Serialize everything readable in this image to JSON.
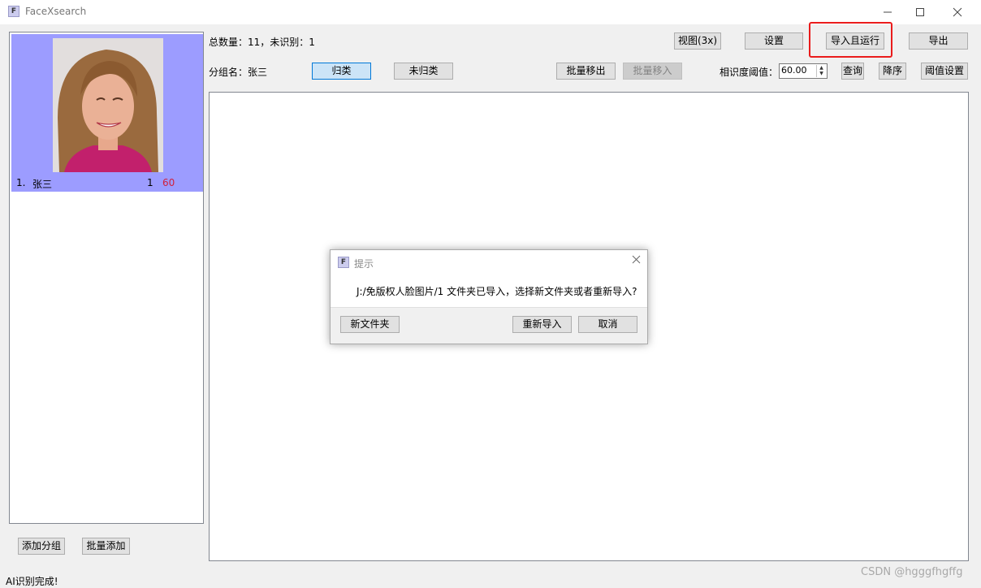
{
  "window": {
    "title": "FaceXsearch",
    "icon_letter": "F"
  },
  "summary": "总数量：11，未识别：1",
  "group_name": "分组名：张三",
  "toolbar": {
    "view_label": "视图(3x)",
    "settings_label": "设置",
    "import_run_label": "导入且运行",
    "export_label": "导出",
    "classified_label": "归类",
    "unclassified_label": "未归类",
    "batch_remove_label": "批量移出",
    "batch_move_in_label": "批量移入",
    "similarity_label": "相识度阈值：",
    "similarity_value": "60.00",
    "query_label": "查询",
    "descending_label": "降序",
    "threshold_settings_label": "阈值设置"
  },
  "groups": [
    {
      "index": "1.",
      "name": "张三",
      "count": "1",
      "score": "60"
    }
  ],
  "sidebar": {
    "add_group_label": "添加分组",
    "batch_add_label": "批量添加"
  },
  "status": "AI识别完成!",
  "dialog": {
    "title": "提示",
    "message": "J:/免版权人脸图片/1 文件夹已导入，选择新文件夹或者重新导入?",
    "new_folder_label": "新文件夹",
    "reimport_label": "重新导入",
    "cancel_label": "取消"
  },
  "watermark": "CSDN @hgggfhgffg",
  "colors": {
    "group_card_bg": "#9c9cff",
    "score_text": "#d0213c",
    "highlight_border": "#ea1c1c",
    "primary_button_bg": "#cce4f7"
  },
  "icons": [
    "app-icon",
    "minimize-icon",
    "maximize-icon",
    "close-icon",
    "spin-arrows-icon"
  ]
}
